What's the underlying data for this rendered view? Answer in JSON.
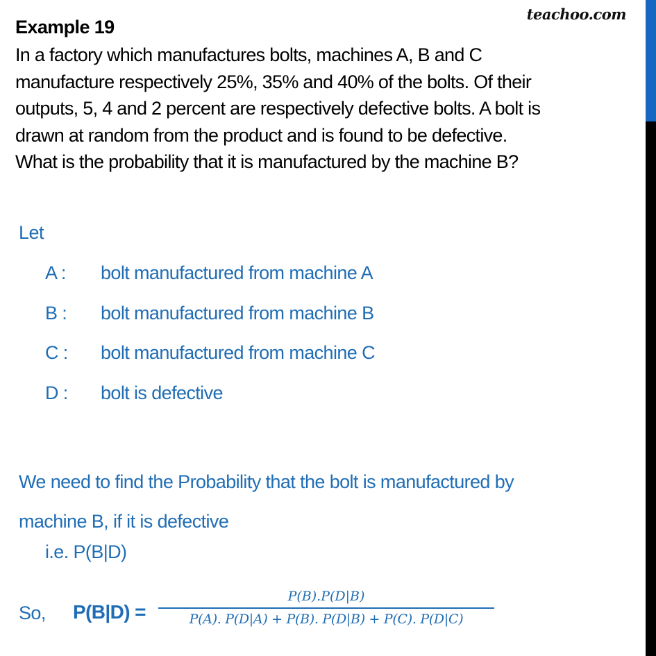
{
  "brand": "teachoo.com",
  "title": "Example 19",
  "question": "In a factory which manufactures bolts, machines A, B and C manufacture respectively 25%, 35% and 40% of the bolts. Of their outputs, 5, 4 and 2 percent are respectively defective bolts. A bolt is drawn at random from the product and is found to be defective. What is the probability that it is manufactured by the machine B?",
  "question_lines": [
    "In a factory which manufactures bolts, machines A, B and C",
    "manufacture respectively 25%, 35% and 40% of the bolts. Of their",
    "outputs, 5, 4 and 2 percent are respectively defective bolts. A bolt is",
    "drawn at random from the product and is found to be defective.",
    "What is the probability that it is manufactured by the machine B?"
  ],
  "solution": {
    "let_label": "Let",
    "definitions": [
      {
        "key": "A :",
        "text": "bolt manufactured from machine A"
      },
      {
        "key": "B :",
        "text": "bolt manufactured from machine B"
      },
      {
        "key": "C :",
        "text": "bolt manufactured from machine C"
      },
      {
        "key": "D :",
        "text": "bolt is defective"
      }
    ],
    "need_lines": [
      "We need to find the Probability that the bolt is manufactured by",
      "machine B, if it is defective"
    ],
    "ie": "i.e. P(B|D)",
    "so_label": "So,",
    "formula_lhs": "P(B|D) =",
    "formula_numerator": "P(B).P(D|B)",
    "formula_denominator": "P(A). P(D|A) + P(B). P(D|B) + P(C). P(D|C)"
  },
  "colors": {
    "text_blue": "#1f6db5",
    "scroll_thumb": "#1767c2",
    "scroll_track": "#000000"
  }
}
